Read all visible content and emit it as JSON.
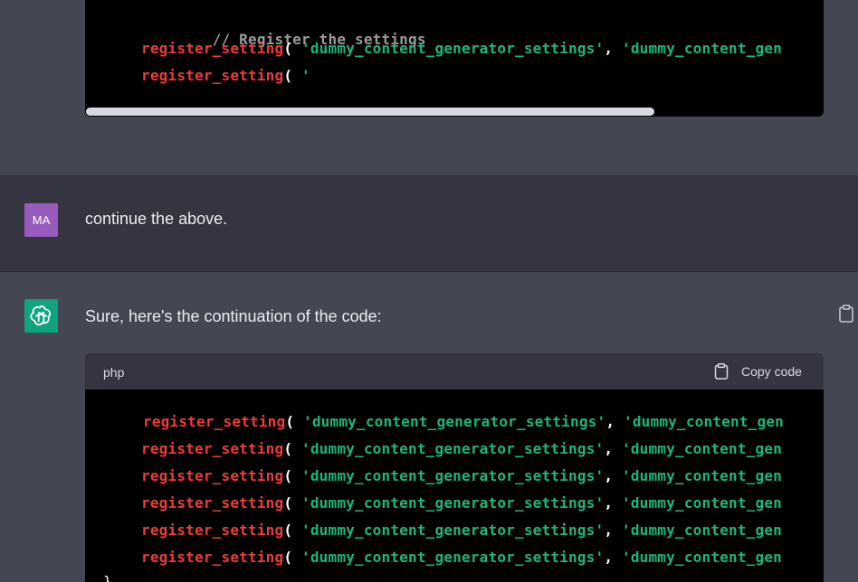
{
  "top_code": {
    "lines": [
      {
        "comment": "// Register the settings"
      },
      {
        "fn": "register_setting",
        "open": "( ",
        "str1": "'dummy_content_generator_settings'",
        "sep": ", ",
        "str2": "'dummy_content_gen"
      },
      {
        "fn": "register_setting",
        "open": "( ",
        "str1": "'"
      }
    ]
  },
  "user_message": {
    "avatar": "MA",
    "text": "continue the above."
  },
  "assistant_message": {
    "text": "Sure, here's the continuation of the code:",
    "code_block": {
      "language": "php",
      "copy_label": "Copy code",
      "lines": [
        {
          "fn": "register_setting",
          "open": "( ",
          "str1": "'dummy_content_generator_settings'",
          "sep": ", ",
          "str2": "'dummy_content_gen"
        },
        {
          "fn": "register_setting",
          "open": "( ",
          "str1": "'dummy_content_generator_settings'",
          "sep": ", ",
          "str2": "'dummy_content_gen"
        },
        {
          "fn": "register_setting",
          "open": "( ",
          "str1": "'dummy_content_generator_settings'",
          "sep": ", ",
          "str2": "'dummy_content_gen"
        },
        {
          "fn": "register_setting",
          "open": "( ",
          "str1": "'dummy_content_generator_settings'",
          "sep": ", ",
          "str2": "'dummy_content_gen"
        },
        {
          "fn": "register_setting",
          "open": "( ",
          "str1": "'dummy_content_generator_settings'",
          "sep": ", ",
          "str2": "'dummy_content_gen"
        },
        {
          "fn": "register_setting",
          "open": "( ",
          "str1": "'dummy_content_generator_settings'",
          "sep": ", ",
          "str2": "'dummy_content_gen"
        },
        {
          "fn": "}"
        }
      ]
    }
  },
  "icons": {
    "gpt_avatar": "openai-logo-icon",
    "clipboard": "clipboard-icon"
  },
  "colors": {
    "bg_assistant": "#444654",
    "bg_user": "#343541",
    "code_bg": "#000000",
    "keyword": "#ef3b3b",
    "string": "#1fb579",
    "comment": "#9a9a9a",
    "user_avatar": "#9a5bbf",
    "gpt_avatar": "#10a37f"
  }
}
